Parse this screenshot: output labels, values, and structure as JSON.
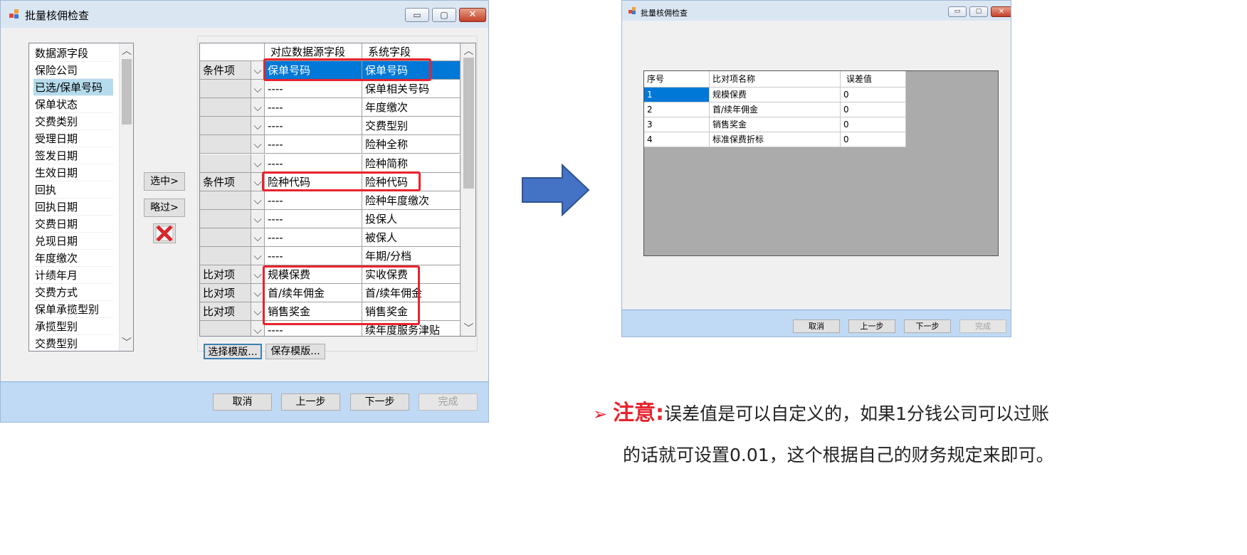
{
  "window1": {
    "title": "批量核佣检查",
    "controls": {
      "minimize": "▭",
      "maximize": "▢",
      "close": "✕"
    },
    "source_list": {
      "items": [
        "数据源字段",
        "保险公司",
        "已选/保单号码",
        "保单状态",
        "交费类别",
        "受理日期",
        "签发日期",
        "生效日期",
        "回执",
        "回执日期",
        "交费日期",
        "兑现日期",
        "年度缴次",
        "计绩年月",
        "交费方式",
        "保单承揽型别",
        "承揽型别",
        "交费型别"
      ],
      "selected_index": 2
    },
    "mid_buttons": {
      "select": "选中>",
      "skip": "略过>"
    },
    "mapping_grid": {
      "headers": [
        "",
        "对应数据源字段",
        "系统字段"
      ],
      "rows": [
        {
          "type": "条件项",
          "source": "保单号码",
          "system": "保单号码"
        },
        {
          "type": "",
          "source": "----",
          "system": "保单相关号码"
        },
        {
          "type": "",
          "source": "----",
          "system": "年度缴次"
        },
        {
          "type": "",
          "source": "----",
          "system": "交费型别"
        },
        {
          "type": "",
          "source": "----",
          "system": "险种全称"
        },
        {
          "type": "",
          "source": "----",
          "system": "险种简称"
        },
        {
          "type": "条件项",
          "source": "险种代码",
          "system": "险种代码"
        },
        {
          "type": "",
          "source": "----",
          "system": "险种年度缴次"
        },
        {
          "type": "",
          "source": "----",
          "system": "投保人"
        },
        {
          "type": "",
          "source": "----",
          "system": "被保人"
        },
        {
          "type": "",
          "source": "----",
          "system": "年期/分档"
        },
        {
          "type": "比对项",
          "source": "规模保费",
          "system": "实收保费"
        },
        {
          "type": "比对项",
          "source": "首/续年佣金",
          "system": "首/续年佣金"
        },
        {
          "type": "比对项",
          "source": "销售奖金",
          "system": "销售奖金"
        },
        {
          "type": "",
          "source": "----",
          "system": "续年度服务津贴"
        }
      ]
    },
    "template_buttons": {
      "choose": "选择模版...",
      "save": "保存模版..."
    },
    "footer_buttons": {
      "cancel": "取消",
      "prev": "上一步",
      "next": "下一步",
      "finish": "完成"
    }
  },
  "window2": {
    "title": "批量核佣检查",
    "controls": {
      "minimize": "▭",
      "maximize": "▢",
      "close": "✕"
    },
    "compare_grid": {
      "headers": [
        "序号",
        "比对项名称",
        "误差值"
      ],
      "rows": [
        {
          "no": "1",
          "name": "规模保费",
          "tolerance": "0"
        },
        {
          "no": "2",
          "name": "首/续年佣金",
          "tolerance": "0"
        },
        {
          "no": "3",
          "name": "销售奖金",
          "tolerance": "0"
        },
        {
          "no": "4",
          "name": "标准保费折标",
          "tolerance": "0"
        }
      ]
    },
    "footer_buttons": {
      "cancel": "取消",
      "prev": "上一步",
      "next": "下一步",
      "finish": "完成"
    }
  },
  "note": {
    "bullet": "➢",
    "label": "注意:",
    "line1": "误差值是可以自定义的，如果1分钱公司可以过账",
    "line2": "的话就可设置0.01，这个根据自己的财务规定来即可。"
  },
  "colors": {
    "arrow": "#4472c4",
    "highlight_box": "#e8232e",
    "selection": "#0078d7",
    "list_selection": "#b5dced"
  }
}
